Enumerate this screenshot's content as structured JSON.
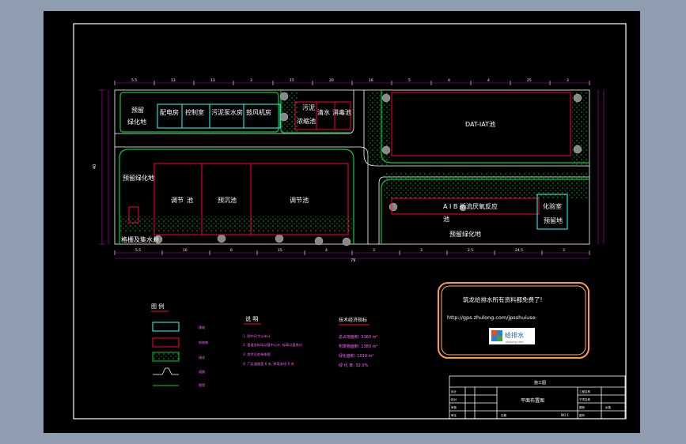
{
  "colors": {
    "background": "#000000",
    "frame": "#ffffff",
    "building": "#ff0033",
    "lab": "#33ffff",
    "greenery": "#00cc33",
    "dimension": "#cc00cc",
    "text": "#ffffff",
    "banner_border": "#ff9944",
    "legend_text": "#ff66ff"
  },
  "top_dimensions": [
    "5.5",
    "13",
    "13",
    "3",
    "15",
    "20",
    "16",
    "5",
    "4",
    "4",
    "25",
    "3"
  ],
  "bottom_dimensions": [
    "5.5",
    "16",
    "6",
    "15",
    "4",
    "3",
    "3",
    "2.5",
    "24.5",
    "3"
  ],
  "overall_dimension": "79",
  "side_dimensions": [
    "40"
  ],
  "buildings": {
    "left_green_1": "预留",
    "left_green_2": "绿化地",
    "power_room": "配电房",
    "control_room": "控制室",
    "sludge_pump": "污泥泵",
    "water_pump": "水房",
    "blower_room": "鼓风机房",
    "sludge_thickener_1": "污泥",
    "sludge_thickener_2": "浓缩池",
    "clear_water": "清水",
    "disinfection": "消毒池",
    "dat_iat": "DAT-IAT池",
    "green_mid_left": "预留绿化地",
    "regulating_1": "调节",
    "regulating_2": "池",
    "primary_settling": "预沉池",
    "equalization": "调节池",
    "aib_1": "A I B 折流厌氧反应",
    "aib_2": "池",
    "lab_1": "化验室",
    "lab_2": "预留地",
    "green_bottom_right": "预留绿化地",
    "collection_well": "格栅及集水井"
  },
  "legend": {
    "title": "图 例",
    "items": [
      "建筑",
      "构筑物",
      "绿化",
      "道路",
      "围墙"
    ]
  },
  "notes": {
    "title": "说 明",
    "lines": [
      "1. 图中尺寸以米计",
      "2. 管道坐标均以管中心计, 标高以管底计",
      "3. 其余见各单体图",
      "4. 厂区道路宽 6 米, 转弯半径 6 米"
    ]
  },
  "tech_econ": {
    "title": "技术经济指标",
    "lines": [
      "总占地面积: 3160 m²",
      "构筑物面积: 1380 m²",
      "绿化面积: 1010 m²",
      "绿 化 率: 32.0%"
    ]
  },
  "banner": {
    "line1": "筑龙给排水所有资料都免费了!",
    "url": "http://gps.zhulong.com/jpsshuiuse",
    "logo_text": "给排水",
    "logo_sub": "zhulong.com"
  },
  "title_block": {
    "design_stage": "施工图",
    "drawing_title": "平面布置图",
    "sheet_no_label": "NO.1",
    "fields": [
      "设计",
      "校对",
      "审核",
      "审定",
      "日期"
    ],
    "right_fields": [
      "工程名称",
      "子项名称",
      "图别",
      "图号"
    ],
    "right_values": [
      "",
      "",
      "水施",
      ""
    ]
  }
}
